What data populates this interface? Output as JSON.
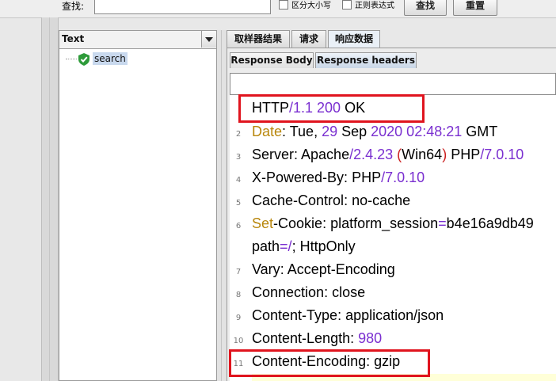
{
  "search": {
    "label": "查找:",
    "value": "",
    "case_sensitive_label": "区分大小写",
    "regex_label": "正则表达式",
    "find_button": "查找",
    "reset_button": "重置"
  },
  "tree": {
    "renderer": "Text",
    "items": [
      {
        "label": "search",
        "status": "success"
      }
    ]
  },
  "tabs": [
    {
      "label": "取样器结果",
      "active": false
    },
    {
      "label": "请求",
      "active": false
    },
    {
      "label": "响应数据",
      "active": true
    }
  ],
  "subtabs": [
    {
      "label": "Response Body",
      "active": false
    },
    {
      "label": "Response headers",
      "active": true
    }
  ],
  "response_headers": {
    "line_numbers": [
      "2",
      "3",
      "4",
      "5",
      "6",
      "7",
      "8",
      "9",
      "10",
      "11"
    ],
    "lines": [
      {
        "key": "HTTP",
        "sep": "/",
        "value": "1.1 200",
        "rest": " OK"
      },
      {
        "key": "Date",
        "sep": ": ",
        "value": "Tue, ",
        "num1": "29",
        "mid": " Sep ",
        "num2": "2020 02:48:21",
        "rest": " GMT"
      },
      {
        "key": "Server",
        "sep": ": ",
        "value": "Apache",
        "op1": "/",
        "num1": "2.4.23",
        "mid": " ",
        "b1": "(",
        "mid2": "Win64",
        "b2": ")",
        "mid3": " PHP",
        "op2": "/",
        "num2": "7.0.10"
      },
      {
        "key": "X-Powered-By",
        "sep": ": ",
        "value": "PHP",
        "op1": "/",
        "num1": "7.0.10"
      },
      {
        "key": "Cache-Control",
        "sep": ": ",
        "value": "no-cache"
      },
      {
        "key1": "Set",
        "sep0": "-",
        "key2": "Cookie",
        "sep": ": ",
        "value": "platform_session",
        "op1": "=",
        "rest": "b4e16a9db49"
      },
      {
        "value": "path",
        "op1": "=/",
        "rest": "; HttpOnly"
      },
      {
        "key": "Vary",
        "sep": ": ",
        "value": "Accept-Encoding"
      },
      {
        "key": "Connection",
        "sep": ": ",
        "value": "close"
      },
      {
        "key": "Content-Type",
        "sep": ": ",
        "value": "application/json"
      },
      {
        "key": "Content-Length",
        "sep": ": ",
        "num1": "980"
      },
      {
        "key": "Content-Encoding",
        "sep": ": ",
        "value": "gzip"
      }
    ]
  },
  "colors": {
    "highlight_box": "#e0141e",
    "keyword": "#b8860b",
    "number": "#7a2fd0",
    "bracket": "#cc1f1f"
  }
}
